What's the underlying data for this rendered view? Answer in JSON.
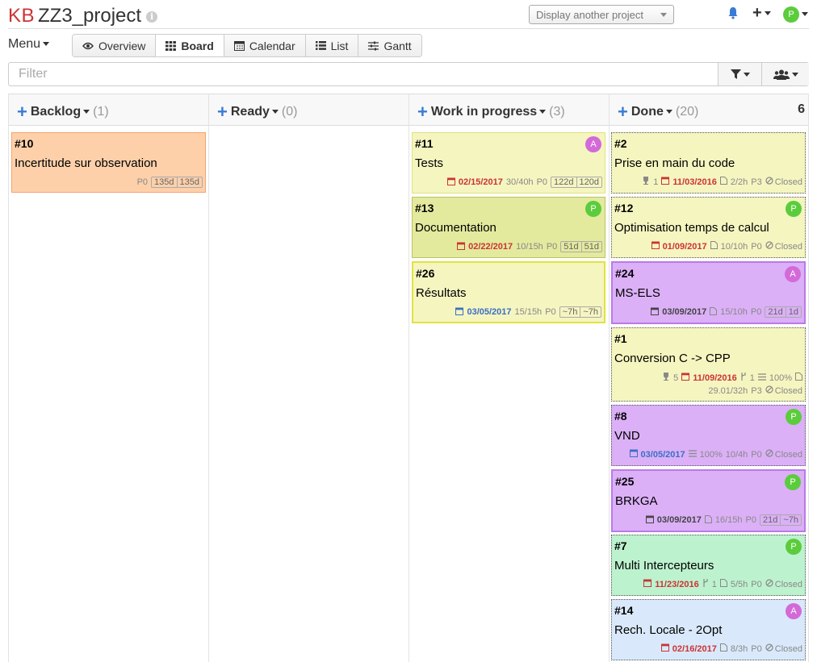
{
  "header": {
    "kb": "KB",
    "project_name": "ZZ3_project",
    "info": "i",
    "project_select": "Display another project",
    "plus": "+",
    "avatar": "P"
  },
  "toolbar": {
    "menu": "Menu",
    "views": [
      {
        "label": "Overview"
      },
      {
        "label": "Board"
      },
      {
        "label": "Calendar"
      },
      {
        "label": "List"
      },
      {
        "label": "Gantt"
      }
    ]
  },
  "filter": {
    "placeholder": "Filter"
  },
  "columns": [
    {
      "title": "Backlog",
      "count": "(1)",
      "limit": ""
    },
    {
      "title": "Ready",
      "count": "(0)",
      "limit": ""
    },
    {
      "title": "Work in progress",
      "count": "(3)",
      "limit": ""
    },
    {
      "title": "Done",
      "count": "(20)",
      "limit": "6"
    }
  ],
  "colors": {
    "orange": "#fdd0aa",
    "yellow": "#f5f5c0",
    "olive": "#e3ea9e",
    "purple": "#dbb0f7",
    "green": "#bdf2cf",
    "blue": "#d9e9fb",
    "accent": "#3a7bd5"
  },
  "cards": {
    "c10": {
      "num": "#10",
      "title": "Incertitude sur observation",
      "p": "P0",
      "t1": "135d",
      "t2": "135d"
    },
    "c11": {
      "num": "#11",
      "title": "Tests",
      "avatar": "A",
      "date": "02/15/2017",
      "hours": "30/40h",
      "p": "P0",
      "t1": "122d",
      "t2": "120d"
    },
    "c13": {
      "num": "#13",
      "title": "Documentation",
      "avatar": "P",
      "date": "02/22/2017",
      "hours": "10/15h",
      "p": "P0",
      "t1": "51d",
      "t2": "51d"
    },
    "c26": {
      "num": "#26",
      "title": "Résultats",
      "date": "03/05/2017",
      "hours": "15/15h",
      "p": "P0",
      "t1": "~7h",
      "t2": "~7h"
    },
    "c2": {
      "num": "#2",
      "title": "Prise en main du code",
      "trophy": "1",
      "date": "11/03/2016",
      "hours": "2/2h",
      "p": "P3",
      "status": "Closed"
    },
    "c12": {
      "num": "#12",
      "title": "Optimisation temps de calcul",
      "avatar": "P",
      "date": "01/09/2017",
      "hours": "10/10h",
      "p": "P0",
      "status": "Closed"
    },
    "c24": {
      "num": "#24",
      "title": "MS-ELS",
      "avatar": "A",
      "date": "03/09/2017",
      "hours": "15/10h",
      "p": "P0",
      "t1": "21d",
      "t2": "1d"
    },
    "c1": {
      "num": "#1",
      "title": "Conversion C -> CPP",
      "trophy": "5",
      "date": "11/09/2016",
      "branch": "1",
      "progress": "100%",
      "hours": "29.01/32h",
      "p": "P3",
      "status": "Closed"
    },
    "c8": {
      "num": "#8",
      "title": "VND",
      "avatar": "P",
      "date": "03/05/2017",
      "progress": "100%",
      "hours": "10/4h",
      "p": "P0",
      "status": "Closed"
    },
    "c25": {
      "num": "#25",
      "title": "BRKGA",
      "avatar": "P",
      "date": "03/09/2017",
      "hours": "16/15h",
      "p": "P0",
      "t1": "21d",
      "t2": "~7h"
    },
    "c7": {
      "num": "#7",
      "title": "Multi Intercepteurs",
      "avatar": "P",
      "date": "11/23/2016",
      "branch": "1",
      "hours": "5/5h",
      "p": "P0",
      "status": "Closed"
    },
    "c14": {
      "num": "#14",
      "title": "Rech. Locale - 2Opt",
      "avatar": "A",
      "date": "02/16/2017",
      "hours": "8/3h",
      "p": "P0",
      "status": "Closed"
    }
  }
}
